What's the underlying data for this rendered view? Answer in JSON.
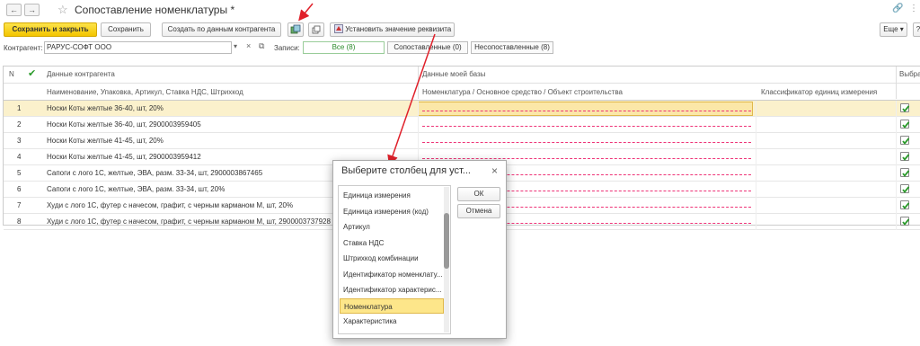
{
  "titlebar": {
    "back_icon": "arrow-left-icon",
    "forward_icon": "arrow-right-icon",
    "back": "←",
    "forward": "→",
    "star": "☆",
    "title": "Сопоставление номенклатуры *",
    "link": "🔗",
    "more": "⋮"
  },
  "toolbar": {
    "save_close": "Сохранить и закрыть",
    "save": "Сохранить",
    "create_by_contractor": "Создать по данным контрагента",
    "set_value": "Установить значение реквизита",
    "more": "Еще ▾",
    "help": "?"
  },
  "filter": {
    "contractor_label": "Контрагент:",
    "contractor_value": "РАРУС-СОФТ ООО",
    "records_label": "Записи:",
    "tab_all": "Все (8)",
    "tab_matched": "Сопоставленные (0)",
    "tab_unmatched": "Несопоставленные (8)",
    "dropdown": "▾",
    "clear": "×",
    "open": "⧉"
  },
  "grid": {
    "col_n": "N",
    "col_contractor": "Данные контрагента",
    "col_contractor_sub": "Наименование, Упаковка, Артикул, Ставка НДС, Штрихкод",
    "col_mybase": "Данные моей базы",
    "col_mybase_sub": "Номенклатура / Основное средство / Объект строительства",
    "col_classifier": "Классификатор единиц измерения",
    "col_selected": "Выбра",
    "rows": [
      {
        "n": "1",
        "text": "Носки Коты желтые 36-40, шт, 20%"
      },
      {
        "n": "2",
        "text": "Носки Коты желтые 36-40, шт, 2900003959405"
      },
      {
        "n": "3",
        "text": "Носки Коты желтые 41-45, шт, 20%"
      },
      {
        "n": "4",
        "text": "Носки Коты желтые 41-45, шт, 2900003959412"
      },
      {
        "n": "5",
        "text": "Сапоги с лого 1С, желтые, ЭВА, разм. 33-34, шт, 2900003867465"
      },
      {
        "n": "6",
        "text": "Сапоги с лого 1С, желтые, ЭВА, разм. 33-34, шт, 20%"
      },
      {
        "n": "7",
        "text": "Худи с лого 1С, футер с начесом, графит, с черным карманом М, шт, 20%"
      },
      {
        "n": "8",
        "text": "Худи с лого 1С, футер с начесом, графит, с черным карманом М, шт, 2900003737928"
      }
    ]
  },
  "dialog": {
    "title": "Выберите столбец для уст...",
    "close": "×",
    "ok": "ОК",
    "cancel": "Отмена",
    "items": [
      "Единица измерения",
      "Единица измерения (код)",
      "Артикул",
      "Ставка НДС",
      "Штрихкод комбинации",
      "Идентификатор номенклату...",
      "Идентификатор характерис...",
      "Номенклатура",
      "Характеристика"
    ],
    "selected_index": 7
  },
  "colors": {
    "accent_yellow": "#f3c500",
    "selection": "#fbf1cc",
    "annotation_red": "#e0202a",
    "check_green": "#2a9a2a"
  }
}
